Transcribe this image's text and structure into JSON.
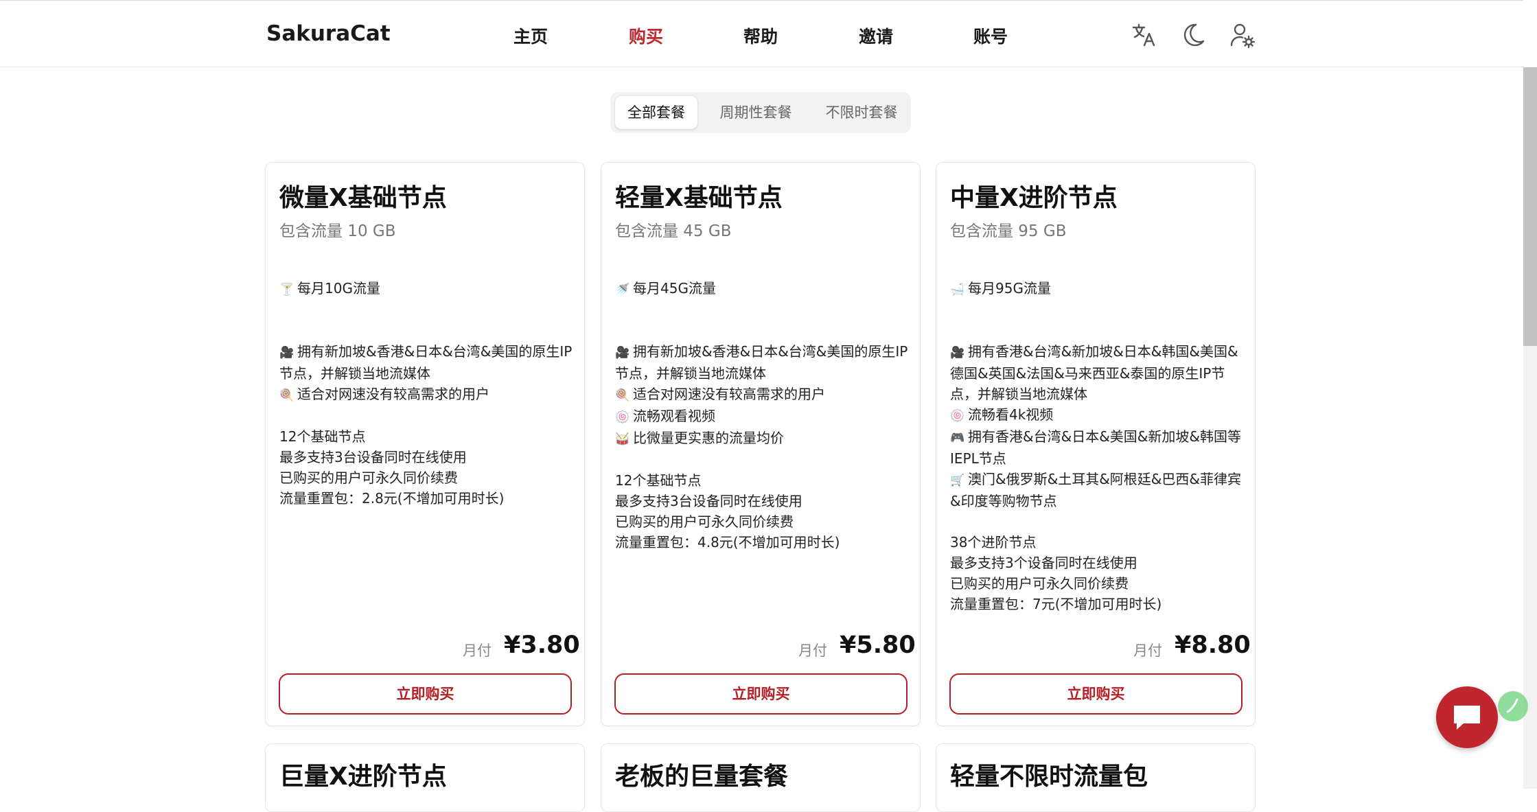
{
  "header": {
    "brand": "SakuraCat",
    "nav": [
      {
        "label": "主页",
        "active": false
      },
      {
        "label": "购买",
        "active": true
      },
      {
        "label": "帮助",
        "active": false
      },
      {
        "label": "邀请",
        "active": false
      },
      {
        "label": "账号",
        "active": false
      }
    ],
    "icons": [
      "translate-icon",
      "moon-icon",
      "user-settings-icon"
    ]
  },
  "tabs": [
    {
      "label": "全部套餐",
      "active": true
    },
    {
      "label": "周期性套餐",
      "active": false
    },
    {
      "label": "不限时套餐",
      "active": false
    }
  ],
  "cards": [
    {
      "title": "微量X基础节点",
      "subtitle": "包含流量 10 GB",
      "lines": [
        {
          "emoji": "🍸",
          "text": "每月10G流量"
        },
        {
          "emoji": "",
          "text": ""
        },
        {
          "emoji": "",
          "text": ""
        },
        {
          "emoji": "🎥",
          "text": "拥有新加坡&香港&日本&台湾&美国的原生IP节点，并解锁当地流媒体"
        },
        {
          "emoji": "🍭",
          "text": "适合对网速没有较高需求的用户"
        },
        {
          "emoji": "",
          "text": ""
        },
        {
          "emoji": "",
          "text": "12个基础节点"
        },
        {
          "emoji": "",
          "text": "最多支持3台设备同时在线使用"
        },
        {
          "emoji": "",
          "text": "已购买的用户可永久同价续费"
        },
        {
          "emoji": "",
          "text": "流量重置包：2.8元(不增加可用时长)"
        }
      ],
      "period": "月付",
      "price": "¥3.80",
      "button": "立即购买"
    },
    {
      "title": "轻量X基础节点",
      "subtitle": "包含流量 45 GB",
      "lines": [
        {
          "emoji": "🚿",
          "text": "每月45G流量"
        },
        {
          "emoji": "",
          "text": ""
        },
        {
          "emoji": "",
          "text": ""
        },
        {
          "emoji": "🎥",
          "text": "拥有新加坡&香港&日本&台湾&美国的原生IP节点，并解锁当地流媒体"
        },
        {
          "emoji": "🍭",
          "text": "适合对网速没有较高需求的用户"
        },
        {
          "emoji": "🍥",
          "text": "流畅观看视频"
        },
        {
          "emoji": "🥁",
          "text": "比微量更实惠的流量均价"
        },
        {
          "emoji": "",
          "text": ""
        },
        {
          "emoji": "",
          "text": "12个基础节点"
        },
        {
          "emoji": "",
          "text": "最多支持3台设备同时在线使用"
        },
        {
          "emoji": "",
          "text": "已购买的用户可永久同价续费"
        },
        {
          "emoji": "",
          "text": "流量重置包：4.8元(不增加可用时长)"
        }
      ],
      "period": "月付",
      "price": "¥5.80",
      "button": "立即购买"
    },
    {
      "title": "中量X进阶节点",
      "subtitle": "包含流量 95 GB",
      "lines": [
        {
          "emoji": "🛁",
          "text": "每月95G流量"
        },
        {
          "emoji": "",
          "text": ""
        },
        {
          "emoji": "",
          "text": ""
        },
        {
          "emoji": "🎥",
          "text": "拥有香港&台湾&新加坡&日本&韩国&美国&德国&英国&法国&马来西亚&泰国的原生IP节点，并解锁当地流媒体"
        },
        {
          "emoji": "🍥",
          "text": "流畅看4k视频"
        },
        {
          "emoji": "🎮",
          "text": "拥有香港&台湾&日本&美国&新加坡&韩国等IEPL节点"
        },
        {
          "emoji": "🛒",
          "text": "澳门&俄罗斯&土耳其&阿根廷&巴西&菲律宾&印度等购物节点"
        },
        {
          "emoji": "",
          "text": ""
        },
        {
          "emoji": "",
          "text": "38个进阶节点"
        },
        {
          "emoji": "",
          "text": "最多支持3个设备同时在线使用"
        },
        {
          "emoji": "",
          "text": "已购买的用户可永久同价续费"
        },
        {
          "emoji": "",
          "text": "流量重置包：7元(不增加可用时长)"
        }
      ],
      "period": "月付",
      "price": "¥8.80",
      "button": "立即购买"
    }
  ],
  "next_cards": [
    {
      "title": "巨量X进阶节点"
    },
    {
      "title": "老板的巨量套餐"
    },
    {
      "title": "轻量不限时流量包"
    }
  ],
  "colors": {
    "accent": "#c0262d",
    "button_border": "#b41f26"
  }
}
